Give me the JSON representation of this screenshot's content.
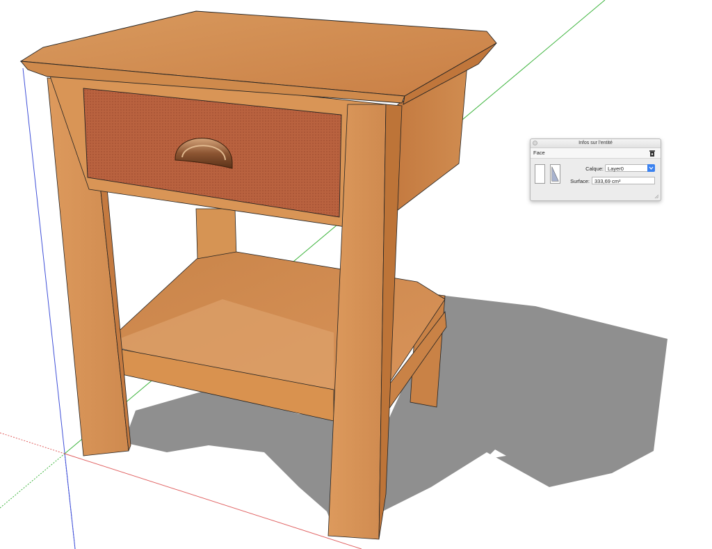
{
  "entity_info": {
    "title": "Infos sur l'entité",
    "type": "Face",
    "layer_label": "Calque:",
    "layer_value": "Layer0",
    "area_label": "Surface:",
    "area_value": "333,69 cm²"
  },
  "icons": {
    "close": "close-icon",
    "info": "entity-info-icon",
    "front_face": "front-face-icon",
    "back_face": "back-face-icon",
    "dropdown": "chevron-down-icon",
    "grip": "resize-grip-icon"
  },
  "colors": {
    "red_axis": "#e06060",
    "green_axis": "#3cb43c",
    "blue_axis": "#3f4fd8",
    "shadow": "#8f8f8f",
    "wood_light": "#d89458",
    "wood_dark": "#b36b36",
    "drawer_front": "#b8613f",
    "accent": "#3b82f0"
  }
}
